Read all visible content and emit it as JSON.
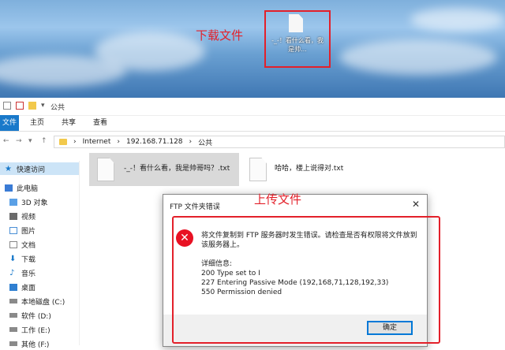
{
  "annotations": {
    "download_label": "下载文件",
    "upload_label": "上传文件"
  },
  "desktop": {
    "file_label": "-_-！看什么看，我是帅..."
  },
  "explorer": {
    "title": "公共",
    "ribbon_tabs": [
      "文件",
      "主页",
      "共享",
      "查看"
    ],
    "address": [
      "Internet",
      "192.168.71.128",
      "公共"
    ],
    "sidebar": [
      {
        "label": "快速访问",
        "icon": "star-icon"
      },
      {
        "label": "此电脑",
        "icon": "pc-icon"
      },
      {
        "label": "3D 对象",
        "icon": "cube-icon"
      },
      {
        "label": "视频",
        "icon": "video-icon"
      },
      {
        "label": "图片",
        "icon": "picture-icon"
      },
      {
        "label": "文档",
        "icon": "document-icon"
      },
      {
        "label": "下载",
        "icon": "download-icon"
      },
      {
        "label": "音乐",
        "icon": "music-icon"
      },
      {
        "label": "桌面",
        "icon": "desktop-icon"
      },
      {
        "label": "本地磁盘 (C:)",
        "icon": "drive-icon"
      },
      {
        "label": "软件 (D:)",
        "icon": "drive-icon"
      },
      {
        "label": "工作 (E:)",
        "icon": "drive-icon"
      },
      {
        "label": "其他 (F:)",
        "icon": "drive-icon"
      }
    ],
    "files": [
      {
        "name": "-_-！看什么看，我是帅哥吗？.txt"
      },
      {
        "name": "哈哈，楼上说得对.txt"
      }
    ]
  },
  "dialog": {
    "title": "FTP 文件夹错误",
    "message": "将文件复制到 FTP 服务器时发生错误。请检查是否有权限将文件放到该服务器上。",
    "details_heading": "详细信息:",
    "details": [
      "200 Type set to I",
      "227 Entering Passive Mode (192,168,71,128,192,33)",
      "550 Permission denied"
    ],
    "ok_label": "确定"
  },
  "colors": {
    "accent": "#1979ca",
    "annotation": "#e3202a",
    "error": "#e81123",
    "selection": "#cce4f7"
  }
}
